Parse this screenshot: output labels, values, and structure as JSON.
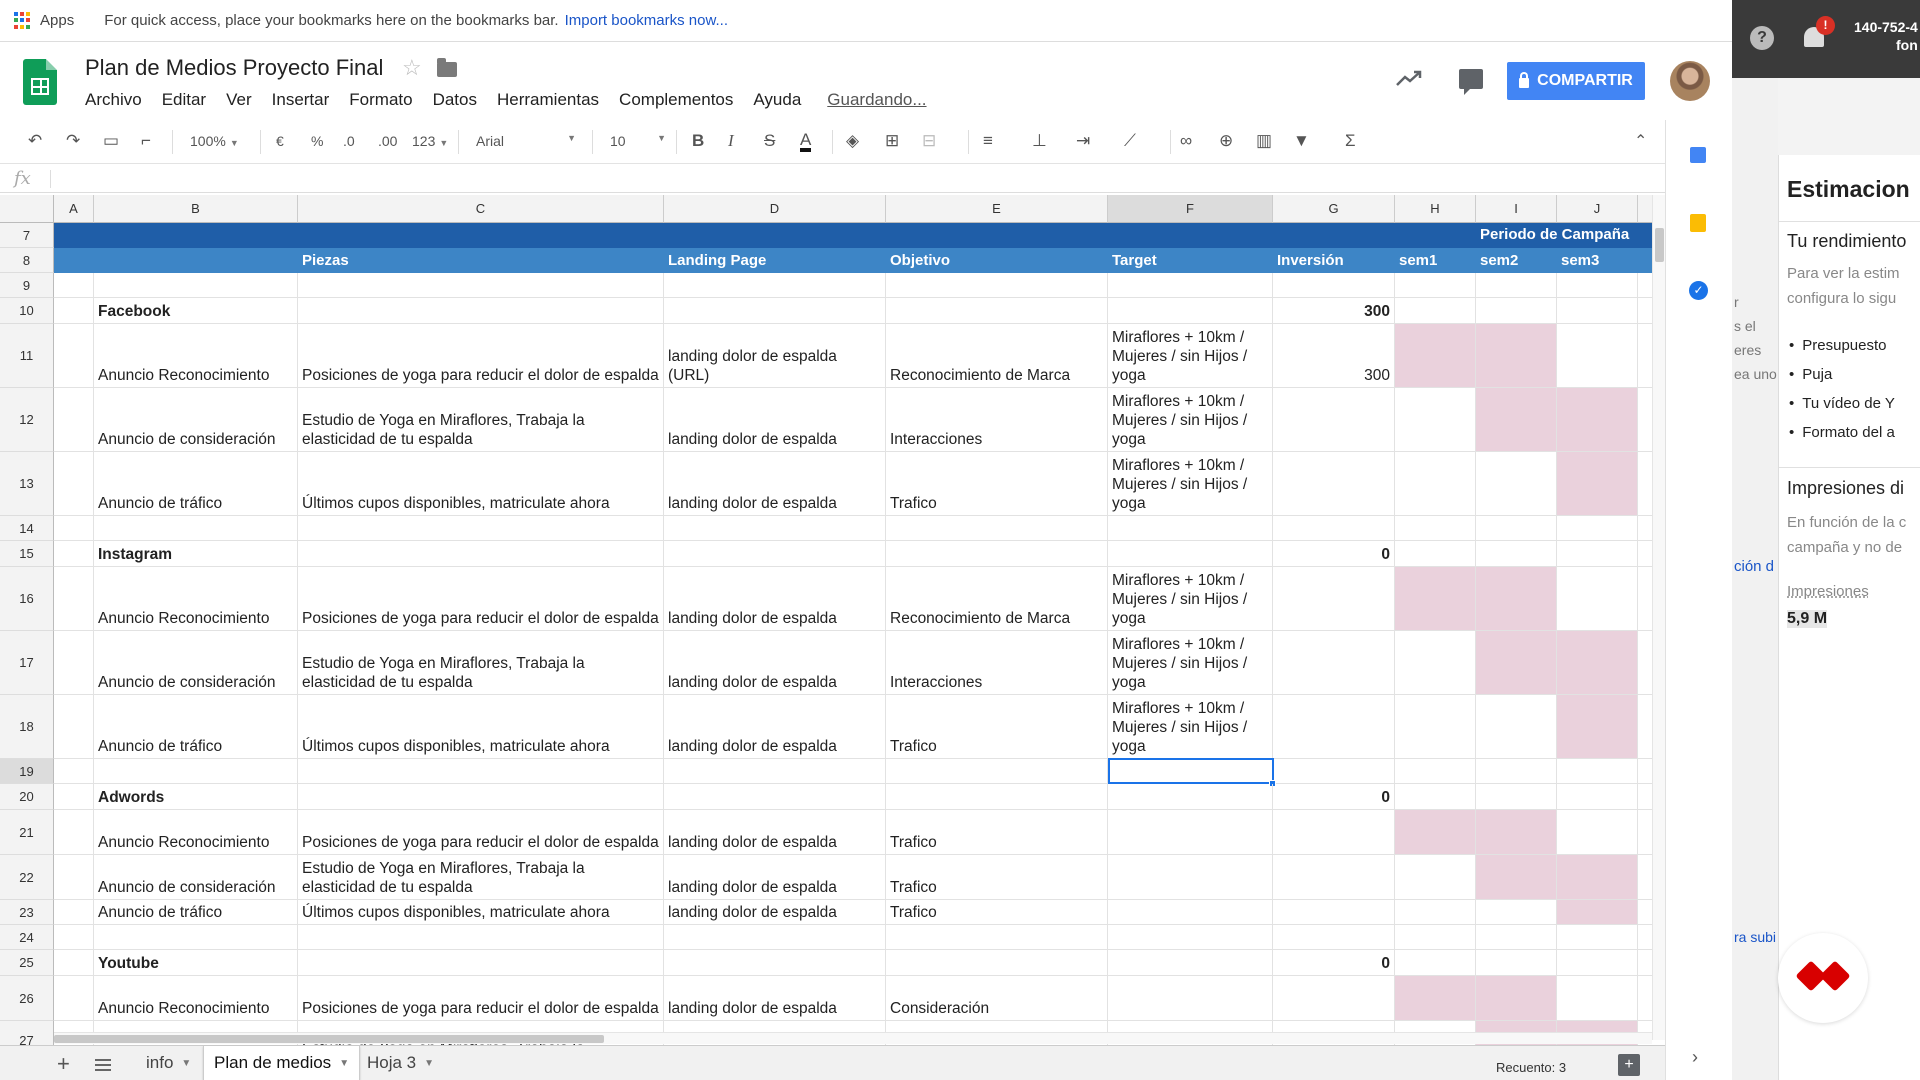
{
  "browser": {
    "apps_label": "Apps",
    "bookmarks_hint": "For quick access, place your bookmarks here on the bookmarks bar.",
    "import_link": "Import bookmarks now..."
  },
  "header": {
    "title": "Plan de Medios Proyecto Final",
    "menu": [
      "Archivo",
      "Editar",
      "Ver",
      "Insertar",
      "Formato",
      "Datos",
      "Herramientas",
      "Complementos",
      "Ayuda"
    ],
    "saving_status": "Guardando...",
    "share_label": "COMPARTIR"
  },
  "toolbar": {
    "zoom": "100%",
    "currency": "€",
    "percent": "%",
    "decimal_less": ".0",
    "decimal_more": ".00",
    "more_formats": "123",
    "font": "Arial",
    "font_size": "10",
    "bold": "B",
    "italic": "I",
    "strike": "S",
    "text_color": "A"
  },
  "formula_bar": {
    "label": "fx",
    "value": ""
  },
  "columns": [
    "A",
    "B",
    "C",
    "D",
    "E",
    "F",
    "G",
    "H",
    "I",
    "J"
  ],
  "header_row": {
    "campaign_label": "Periodo de Campaña",
    "labels": [
      "",
      "",
      "Piezas",
      "Landing Page",
      "Objetivo",
      "Target",
      "Inversión",
      "sem1",
      "sem2",
      "sem3"
    ]
  },
  "rows": [
    {
      "n": "7",
      "type": "hd1"
    },
    {
      "n": "8",
      "type": "hd2"
    },
    {
      "n": "9",
      "type": "blank"
    },
    {
      "n": "10",
      "type": "group",
      "name": "Facebook",
      "amount": "300"
    },
    {
      "n": "11",
      "type": "item",
      "b": "Anuncio Reconocimiento",
      "c": "Posiciones de yoga para reducir el dolor de espalda",
      "d": "landing dolor de espalda (URL)",
      "e": "Reconocimiento de Marca",
      "f": "Miraflores + 10km / Mujeres / sin Hijos / yoga",
      "g": "300",
      "pink": [
        1,
        1,
        0
      ]
    },
    {
      "n": "12",
      "type": "item",
      "b": "Anuncio de consideración",
      "c": "Estudio de Yoga en Miraflores, Trabaja la elasticidad de tu espalda",
      "d": "landing dolor de espalda",
      "e": "Interacciones",
      "f": "Miraflores + 10km / Mujeres / sin Hijos / yoga",
      "g": "",
      "pink": [
        0,
        1,
        1
      ]
    },
    {
      "n": "13",
      "type": "item",
      "b": "Anuncio de tráfico",
      "c": "Últimos cupos disponibles, matriculate ahora",
      "d": "landing dolor de espalda",
      "e": "Trafico",
      "f": "Miraflores + 10km / Mujeres / sin Hijos / yoga",
      "g": "",
      "pink": [
        0,
        0,
        1
      ]
    },
    {
      "n": "14",
      "type": "blank"
    },
    {
      "n": "15",
      "type": "group",
      "name": "Instagram",
      "amount": "0"
    },
    {
      "n": "16",
      "type": "item",
      "b": "Anuncio Reconocimiento",
      "c": "Posiciones de yoga para reducir el dolor de espalda",
      "d": "landing dolor de espalda",
      "e": "Reconocimiento de Marca",
      "f": "Miraflores + 10km / Mujeres / sin Hijos / yoga",
      "g": "",
      "pink": [
        1,
        1,
        0
      ]
    },
    {
      "n": "17",
      "type": "item",
      "b": "Anuncio de consideración",
      "c": "Estudio de Yoga en Miraflores, Trabaja la elasticidad de tu espalda",
      "d": "landing dolor de espalda",
      "e": "Interacciones",
      "f": "Miraflores + 10km / Mujeres / sin Hijos / yoga",
      "g": "",
      "pink": [
        0,
        1,
        1
      ]
    },
    {
      "n": "18",
      "type": "item",
      "b": "Anuncio de tráfico",
      "c": "Últimos cupos disponibles, matriculate ahora",
      "d": "landing dolor de espalda",
      "e": "Trafico",
      "f": "Miraflores + 10km / Mujeres / sin Hijos / yoga",
      "g": "",
      "pink": [
        0,
        0,
        1
      ]
    },
    {
      "n": "19",
      "type": "blank",
      "selected": true
    },
    {
      "n": "20",
      "type": "group",
      "name": "Adwords",
      "amount": "0"
    },
    {
      "n": "21",
      "type": "item",
      "b": "Anuncio Reconocimiento",
      "c": "Posiciones de yoga para reducir el dolor de espalda",
      "d": "landing dolor de espalda",
      "e": "Trafico",
      "f": "",
      "g": "",
      "pink": [
        1,
        1,
        0
      ]
    },
    {
      "n": "22",
      "type": "item",
      "b": "Anuncio de consideración",
      "c": "Estudio de Yoga en Miraflores, Trabaja la elasticidad de tu espalda",
      "d": "landing dolor de espalda",
      "e": "Trafico",
      "f": "",
      "g": "",
      "pink": [
        0,
        1,
        1
      ]
    },
    {
      "n": "23",
      "type": "item",
      "b": "Anuncio de tráfico",
      "c": "Últimos cupos disponibles, matriculate ahora",
      "d": "landing dolor de espalda",
      "e": "Trafico",
      "f": "",
      "g": "",
      "pink": [
        0,
        0,
        1
      ]
    },
    {
      "n": "24",
      "type": "blank"
    },
    {
      "n": "25",
      "type": "group",
      "name": "Youtube",
      "amount": "0"
    },
    {
      "n": "26",
      "type": "item",
      "b": "Anuncio Reconocimiento",
      "c": "Posiciones de yoga para reducir el dolor de espalda",
      "d": "landing dolor de espalda",
      "e": "Consideración",
      "f": "",
      "g": "",
      "pink": [
        1,
        1,
        0
      ]
    },
    {
      "n": "27",
      "type": "item",
      "b": "",
      "c": "Estudio de Yoga en Miraflores, Trabaja la",
      "d": "",
      "e": "",
      "f": "",
      "g": "",
      "pink": [
        0,
        1,
        1
      ]
    }
  ],
  "sheets": {
    "tabs": [
      "info",
      "Plan de medios",
      "Hoja 3"
    ],
    "active": "Plan de medios"
  },
  "status": {
    "count": "Recuento: 3"
  },
  "overlay": {
    "account_id": "140-752-4",
    "account_sub": "fon",
    "notification_badge": "!",
    "side_fragments": [
      "r",
      "s el",
      "eres",
      "ea uno",
      "ción d",
      "ra subi"
    ],
    "estimation_title": "Estimacion",
    "performance_title": "Tu rendimiento",
    "performance_desc_1": "Para ver la estim",
    "performance_desc_2": "configura lo sigu",
    "bullets": [
      "Presupuesto",
      "Puja",
      "Tu vídeo de Y",
      "Formato del a"
    ],
    "impressions_title": "Impresiones di",
    "impressions_desc_1": "En función de la c",
    "impressions_desc_2": "campaña y no de",
    "impressions_label": "Impresiones",
    "impressions_value": "5,9 M"
  }
}
